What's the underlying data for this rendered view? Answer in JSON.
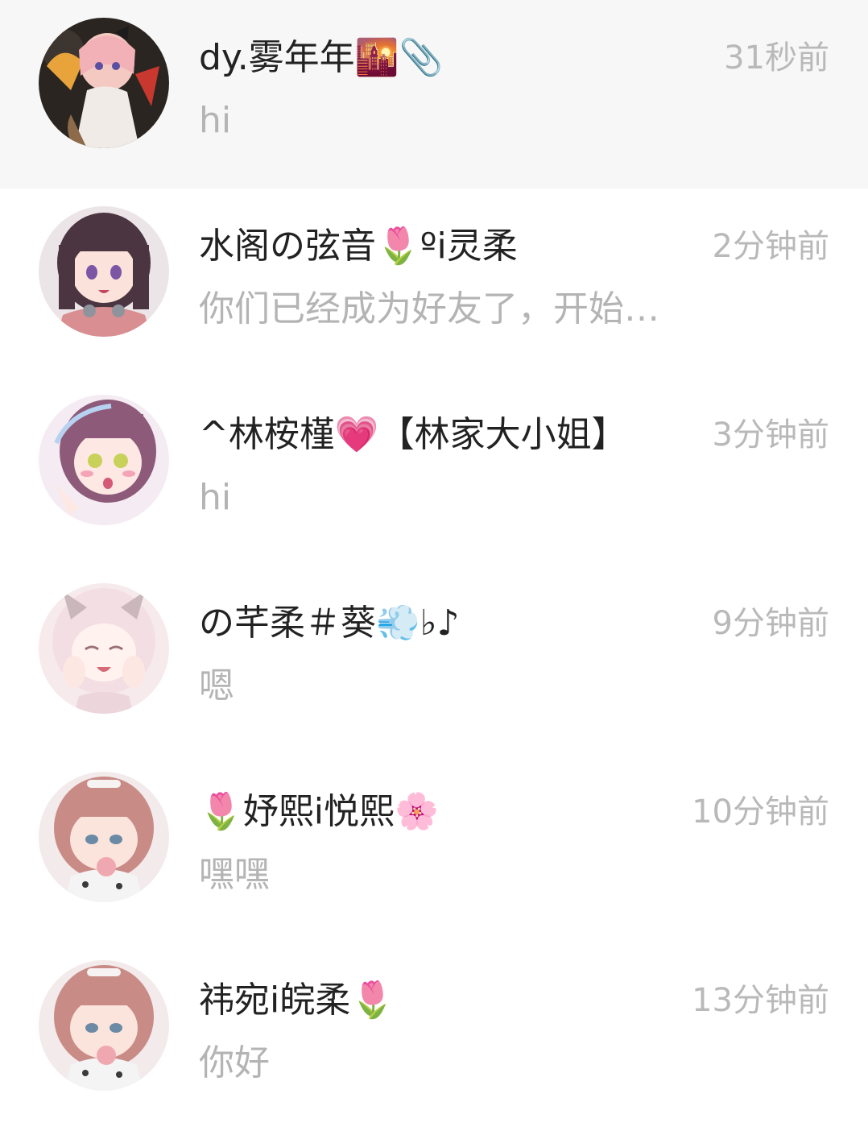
{
  "conversations": [
    {
      "name": "dy.雾年年🌇📎",
      "preview": "hi",
      "time": "31秒前",
      "avatar_icon": "anime-girl-dark-avatar"
    },
    {
      "name": "水阁の弦音🌷ºi灵柔",
      "preview": "你们已经成为好友了，开始…",
      "time": "2分钟前",
      "avatar_icon": "anime-girl-brown-hair-avatar"
    },
    {
      "name": "^林桉槿💗【林家大小姐】",
      "preview": "hi",
      "time": "3分钟前",
      "avatar_icon": "anime-girl-purple-hair-avatar"
    },
    {
      "name": "の芊柔＃葵💨♭♪",
      "preview": "嗯",
      "time": "9分钟前",
      "avatar_icon": "anime-girl-white-hair-avatar"
    },
    {
      "name": "🌷妤熙i悦熙🌸",
      "preview": "嘿嘿",
      "time": "10分钟前",
      "avatar_icon": "anime-girl-pink-hair-avatar"
    },
    {
      "name": "祎宛i皖柔🌷",
      "preview": "你好",
      "time": "13分钟前",
      "avatar_icon": "anime-girl-pink-hair-avatar"
    }
  ],
  "colors": {
    "name_text": "#222222",
    "preview_text": "#b4b4b4",
    "time_text": "#b9b9b9",
    "highlight_row": "#f7f7f7"
  }
}
